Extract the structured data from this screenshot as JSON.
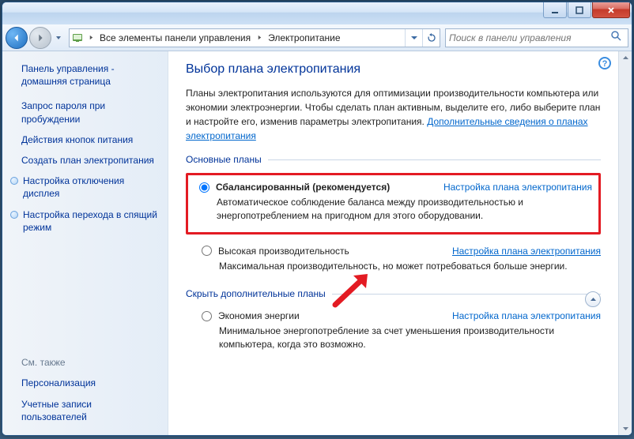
{
  "breadcrumb": {
    "root": "Все элементы панели управления",
    "current": "Электропитание"
  },
  "search": {
    "placeholder": "Поиск в панели управления"
  },
  "sidebar": {
    "heading": "Панель управления - домашняя страница",
    "links": [
      "Запрос пароля при пробуждении",
      "Действия кнопок питания",
      "Создать план электропитания"
    ],
    "bulletLinks": [
      "Настройка отключения дисплея",
      "Настройка перехода в спящий режим"
    ],
    "alsoHeading": "См. также",
    "alsoLinks": [
      "Персонализация",
      "Учетные записи пользователей"
    ]
  },
  "page": {
    "title": "Выбор плана электропитания",
    "intro1": "Планы электропитания используются для оптимизации производительности компьютера или экономии электроэнергии. Чтобы сделать план активным, выделите его, либо выберите план и настройте его, изменив параметры электропитания. ",
    "introLink": "Дополнительные сведения о планах электропитания"
  },
  "groups": {
    "main": "Основные планы",
    "hide": "Скрыть дополнительные планы"
  },
  "plans": {
    "balanced": {
      "label": "Сбалансированный (рекомендуется)",
      "link": "Настройка плана электропитания",
      "desc": "Автоматическое соблюдение баланса между производительностью и энергопотреблением на пригодном для этого оборудовании."
    },
    "high": {
      "label": "Высокая производительность",
      "link": "Настройка плана электропитания",
      "desc": "Максимальная производительность, но может потребоваться больше энергии."
    },
    "eco": {
      "label": "Экономия энергии",
      "link": "Настройка плана электропитания",
      "desc": "Минимальное энергопотребление за счет уменьшения производительности компьютера, когда это возможно."
    }
  }
}
